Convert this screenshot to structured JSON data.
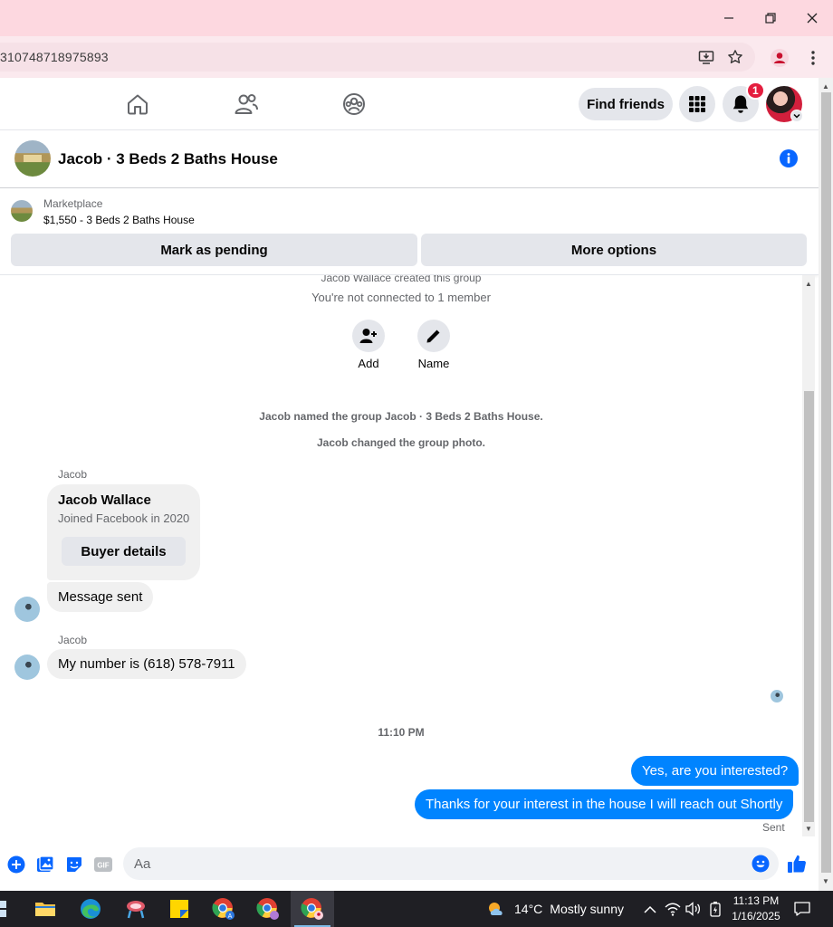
{
  "browser": {
    "url": "310748718975893"
  },
  "nav": {
    "find_friends_label": "Find friends",
    "notification_count": "1"
  },
  "chat": {
    "title": "Jacob · 3 Beds 2 Baths House"
  },
  "marketplace": {
    "label": "Marketplace",
    "listing": "$1,550 - 3 Beds 2 Baths House",
    "mark_pending_label": "Mark as pending",
    "more_options_label": "More options"
  },
  "messages": {
    "created_text": "Jacob Wallace created this group",
    "connected_text": "You're not connected to 1 member",
    "add_label": "Add",
    "name_label": "Name",
    "named_event": "Jacob named the group Jacob · 3 Beds 2 Baths House.",
    "photo_event": "Jacob changed the group photo.",
    "card_sender": "Jacob",
    "card_name": "Jacob Wallace",
    "card_sub": "Joined Facebook in 2020",
    "buyer_details_label": "Buyer details",
    "message_sent": "Message sent",
    "number_sender": "Jacob",
    "number_msg": "My number is (618) 578-7911",
    "timestamp": "11:10 PM",
    "out_msg_1": "Yes, are you interested?",
    "out_msg_2": "Thanks for your interest in the house I will reach out Shortly",
    "sent_status": "Sent"
  },
  "composer": {
    "placeholder": "Aa"
  },
  "taskbar": {
    "weather_temp": "14°C",
    "weather_desc": "Mostly sunny",
    "time": "11:13 PM",
    "date": "1/16/2025"
  }
}
